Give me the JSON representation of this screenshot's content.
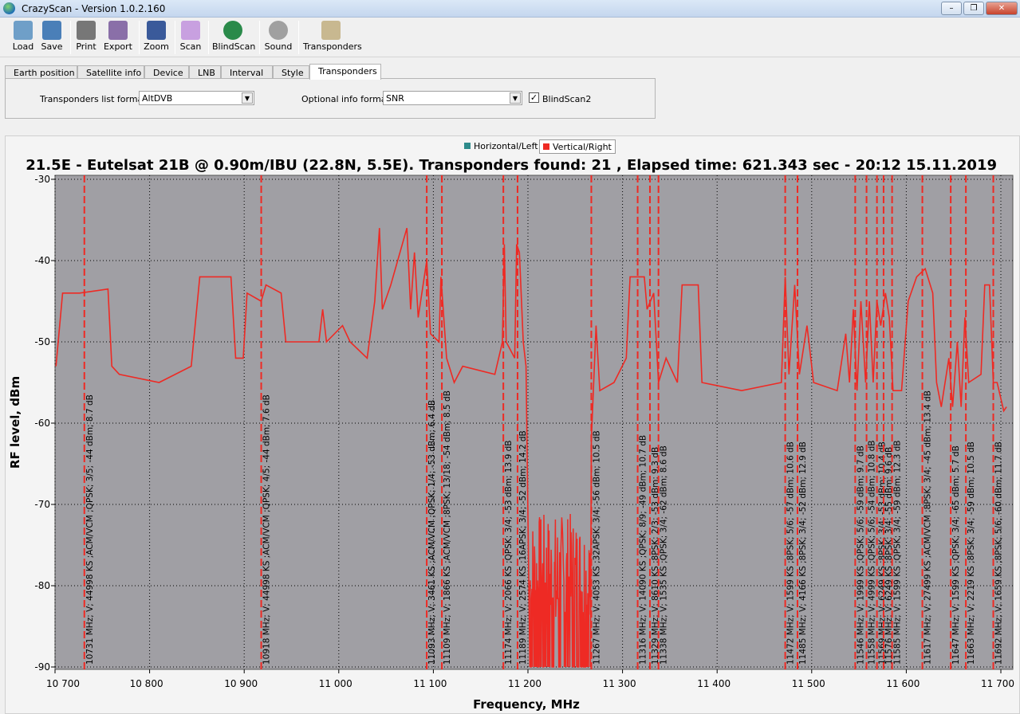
{
  "window": {
    "title": "CrazyScan - Version 1.0.2.160",
    "min": "–",
    "max": "❐",
    "close": "✕"
  },
  "toolbar": [
    {
      "id": "load",
      "label": "Load",
      "color": "#6f9fc8"
    },
    {
      "id": "save",
      "label": "Save",
      "color": "#4a7fb8"
    },
    {
      "id": "print",
      "label": "Print",
      "color": "#777"
    },
    {
      "id": "export",
      "label": "Export",
      "color": "#8a6fa8"
    },
    {
      "id": "zoom",
      "label": "Zoom",
      "color": "#3a5a9a"
    },
    {
      "id": "scan",
      "label": "Scan",
      "color": "#c8a0e0"
    },
    {
      "id": "blindscan",
      "label": "BlindScan",
      "color": "#2a8a4a"
    },
    {
      "id": "sound",
      "label": "Sound",
      "color": "#a0a0a0"
    },
    {
      "id": "transponders",
      "label": "Transponders",
      "color": "#c8b890"
    }
  ],
  "tabs": [
    "Earth position",
    "Satellite info",
    "Device",
    "LNB",
    "Interval",
    "Style",
    "Transponders"
  ],
  "active_tab": "Transponders",
  "panel": {
    "list_format_label": "Transponders list format",
    "list_format_value": "AltDVB",
    "optional_label": "Optional info format",
    "optional_value": "SNR",
    "blindscan2_label": "BlindScan2",
    "blindscan2_checked": true,
    "check": "✓"
  },
  "legend": [
    {
      "label": "Horizontal/Left",
      "color": "#2e8b8b"
    },
    {
      "label": "Vertical/Right",
      "color": "#ee2a24"
    }
  ],
  "chart_data": {
    "type": "line",
    "title": "21.5E - Eutelsat 21B @ 0.90m/IBU (22.8N, 5.5E). Transponders found: 21 , Elapsed time: 621.343 sec - 20:12 15.11.2019",
    "xlabel": "Frequency, MHz",
    "ylabel": "RF level, dBm",
    "xlim": [
      10700,
      11713
    ],
    "ylim": [
      -90,
      -30
    ],
    "xticks": [
      10700,
      10800,
      10900,
      11000,
      11100,
      11200,
      11300,
      11400,
      11500,
      11600,
      11700
    ],
    "xtick_labels": [
      "10 700",
      "10 800",
      "10 900",
      "11 000",
      "11 100",
      "11 200",
      "11 300",
      "11 400",
      "11 500",
      "11 600",
      "11 700"
    ],
    "yticks": [
      -30,
      -40,
      -50,
      -60,
      -70,
      -80,
      -90
    ],
    "ytick_labels": [
      "-30",
      "-40",
      "-50",
      "-60",
      "-70",
      "-80",
      "-90"
    ],
    "grid": true,
    "series": [
      {
        "name": "Vertical/Right",
        "color": "#ee2a24",
        "points": [
          [
            10701,
            -53
          ],
          [
            10708,
            -44
          ],
          [
            10726,
            -44
          ],
          [
            10756,
            -43.5
          ],
          [
            10760,
            -53
          ],
          [
            10768,
            -54
          ],
          [
            10810,
            -55
          ],
          [
            10844,
            -53
          ],
          [
            10853,
            -42
          ],
          [
            10886,
            -42
          ],
          [
            10891,
            -52
          ],
          [
            10899,
            -52
          ],
          [
            10903,
            -44
          ],
          [
            10918,
            -45
          ],
          [
            10923,
            -43
          ],
          [
            10939,
            -44
          ],
          [
            10944,
            -50
          ],
          [
            10979,
            -50
          ],
          [
            10983,
            -46
          ],
          [
            10987,
            -50
          ],
          [
            11004,
            -48
          ],
          [
            11012,
            -50
          ],
          [
            11030,
            -52
          ],
          [
            11038,
            -45
          ],
          [
            11043,
            -36
          ],
          [
            11046,
            -46
          ],
          [
            11055,
            -43
          ],
          [
            11072,
            -36
          ],
          [
            11076,
            -46
          ],
          [
            11080,
            -39
          ],
          [
            11084,
            -47
          ],
          [
            11093,
            -40
          ],
          [
            11097,
            -49
          ],
          [
            11106,
            -50
          ],
          [
            11108,
            -42
          ],
          [
            11114,
            -52
          ],
          [
            11122,
            -55
          ],
          [
            11131,
            -53
          ],
          [
            11165,
            -54
          ],
          [
            11173,
            -50
          ],
          [
            11175,
            -38
          ],
          [
            11177,
            -50
          ],
          [
            11186,
            -52
          ],
          [
            11188,
            -38
          ],
          [
            11191,
            -39
          ],
          [
            11195,
            -50
          ],
          [
            11198,
            -53
          ],
          [
            11202,
            -90
          ]
        ]
      },
      {
        "name": "Vertical/Right (cont.)",
        "color": "#ee2a24",
        "points": [
          [
            11266,
            -90
          ],
          [
            11267,
            -62
          ],
          [
            11272,
            -48
          ],
          [
            11276,
            -56
          ],
          [
            11291,
            -55
          ],
          [
            11304,
            -52
          ],
          [
            11308,
            -42
          ],
          [
            11323,
            -42
          ],
          [
            11326,
            -46
          ],
          [
            11333,
            -44
          ],
          [
            11338,
            -55
          ],
          [
            11346,
            -52
          ],
          [
            11358,
            -55
          ],
          [
            11363,
            -43
          ],
          [
            11380,
            -43
          ],
          [
            11384,
            -55
          ],
          [
            11426,
            -56
          ],
          [
            11468,
            -55
          ],
          [
            11472,
            -42
          ],
          [
            11476,
            -54
          ],
          [
            11482,
            -43
          ],
          [
            11487,
            -54
          ],
          [
            11495,
            -48
          ],
          [
            11502,
            -55
          ],
          [
            11527,
            -56
          ],
          [
            11536,
            -49
          ],
          [
            11540,
            -55
          ],
          [
            11544,
            -46
          ],
          [
            11548,
            -56
          ],
          [
            11552,
            -45
          ],
          [
            11557,
            -55
          ],
          [
            11561,
            -45
          ],
          [
            11565,
            -55
          ],
          [
            11569,
            -45
          ],
          [
            11573,
            -48
          ],
          [
            11578,
            -44
          ],
          [
            11582,
            -47
          ],
          [
            11586,
            -56
          ],
          [
            11595,
            -56
          ],
          [
            11602,
            -45
          ],
          [
            11611,
            -42
          ],
          [
            11620,
            -41
          ],
          [
            11628,
            -44
          ],
          [
            11632,
            -55
          ],
          [
            11637,
            -58
          ],
          [
            11645,
            -52
          ],
          [
            11649,
            -58
          ],
          [
            11654,
            -50
          ],
          [
            11658,
            -58
          ],
          [
            11662,
            -47
          ],
          [
            11666,
            -55
          ],
          [
            11679,
            -54
          ],
          [
            11683,
            -43
          ],
          [
            11688,
            -43
          ],
          [
            11692,
            -55
          ],
          [
            11696,
            -55
          ],
          [
            11703,
            -58.5
          ],
          [
            11706,
            -58
          ]
        ]
      }
    ],
    "noise_band": {
      "from": 11202,
      "to": 11266,
      "min": -90,
      "max": -71
    },
    "transponders": [
      {
        "freq": 10731,
        "label": "10731 MHz; V; 44998 KS ;ACM/VCM ;QPSK; 3/5; -44 dBm; 8.7 dB"
      },
      {
        "freq": 10918,
        "label": "10918 MHz; V; 44998 KS ;ACM/VCM ;QPSK; 4/5; -44 dBm; 7.6 dB"
      },
      {
        "freq": 11093,
        "label": "11093 MHz; V; 3461 KS ;ACM/VCM ;QPSK; 1/4; -53 dBm; 6.4 dB"
      },
      {
        "freq": 11109,
        "label": "11109 MHz; V; 1866 KS ;ACM/VCM ;8PSK; 13/18; -54 dBm; 8.5 dB"
      },
      {
        "freq": 11174,
        "label": "11174 MHz; V; 2066 KS ;QPSK; 3/4; -53 dBm; 13.9 dB"
      },
      {
        "freq": 11189,
        "label": "11189 MHz; V; 2574 KS ;16APSK; 3/4; -52 dBm; 14.2 dB"
      },
      {
        "freq": 11267,
        "label": "11267 MHz; V; 4053 KS ;32APSK; 3/4; -56 dBm; 10.5 dB"
      },
      {
        "freq": 11316,
        "label": "11316 MHz; V; 14090 KS ;QPSK; 8/9; -49 dBm; 10.7 dB"
      },
      {
        "freq": 11329,
        "label": "11329 MHz; V; 8610 KS ;8PSK; 2/3; -53 dBm; 9.3 dB"
      },
      {
        "freq": 11338,
        "label": "11338 MHz; V; 1535 KS ;QPSK; 3/4; -62 dBm; 8.6 dB"
      },
      {
        "freq": 11472,
        "label": "11472 MHz; V; 1599 KS ;8PSK; 5/6; -57 dBm; 10.6 dB"
      },
      {
        "freq": 11485,
        "label": "11485 MHz; V; 4166 KS ;8PSK; 3/4; -52 dBm; 12.9 dB"
      },
      {
        "freq": 11546,
        "label": "11546 MHz; V; 1999 KS ;QPSK; 5/6; -59 dBm; 9.7 dB"
      },
      {
        "freq": 11558,
        "label": "11558 MHz; V; 4999 KS ;QPSK; 5/6; -54 dBm; 10.8 dB"
      },
      {
        "freq": 11569,
        "label": "11569 MHz; V; 6249 KS ;8PSK; 3/4; -53 dBm; 10.4 dB"
      },
      {
        "freq": 11576,
        "label": "11576 MHz; V; 6249 KS ;8PSK; 3/4; -55 dBm; 9.6 dB"
      },
      {
        "freq": 11585,
        "label": "11585 MHz; V; 1599 KS ;QPSK; 3/4; -59 dBm; 12.3 dB"
      },
      {
        "freq": 11617,
        "label": "11617 MHz; V; 27499 KS ;ACM/VCM ;8PSK; 3/4; -45 dBm; 13.4 dB"
      },
      {
        "freq": 11647,
        "label": "11647 MHz; V; 1599 KS ;QPSK; 3/4; -65 dBm; 5.7 dB"
      },
      {
        "freq": 11663,
        "label": "11663 MHz; V; 2219 KS ;8PSK; 3/4; -59 dBm; 10.5 dB"
      },
      {
        "freq": 11692,
        "label": "11692 MHz; V; 1659 KS ;8PSK; 5/6; -60 dBm; 11.7 dB"
      }
    ]
  }
}
